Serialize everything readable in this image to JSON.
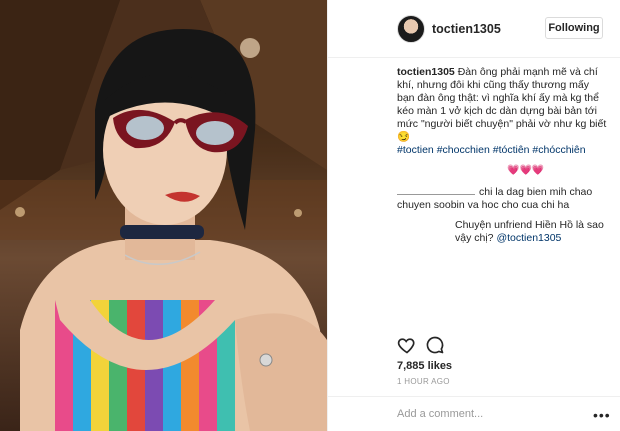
{
  "post": {
    "username": "toctien1305",
    "follow_label": "Following"
  },
  "caption": {
    "username": "toctien1305",
    "text": "Đàn ông phải mạnh mẽ và chí khí, nhưng đôi khi cũng thấy thương mấy bạn đàn ông thật: vì nghĩa khí ấy mà kg thể kéo màn 1 vở kịch dc dàn dựng bài bản tới mức \"người biết chuyện\" phải vờ như kg biết😏",
    "hashtags": "#toctien #chocchien #tóctiên #chócchiên"
  },
  "comments": {
    "hearts": "💗💗💗",
    "comment2": "chi la dag bien mih chao chuyen soobin va hoc cho cua chi ha",
    "comment3_text": "Chuyện unfriend Hiền Hồ là sao vậy chị? ",
    "comment3_mention": "@toctien1305"
  },
  "meta": {
    "likes": "7,885 likes",
    "time_ago": "1 HOUR AGO"
  },
  "input": {
    "placeholder": "Add a comment..."
  },
  "icons": {
    "like": "heart-icon",
    "comment": "comment-bubble-icon",
    "more": "more-options-icon"
  }
}
